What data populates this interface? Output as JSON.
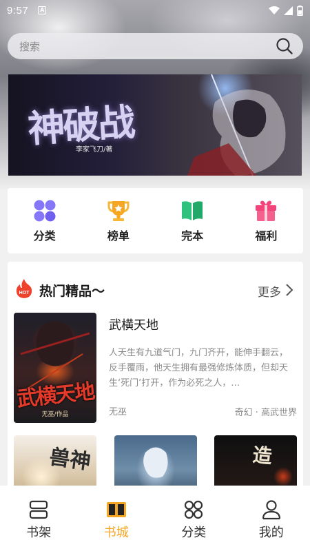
{
  "status_bar": {
    "time": "9:57",
    "notification_glyph": "A"
  },
  "search": {
    "placeholder": "搜索"
  },
  "banner": {
    "title": "神破战",
    "author": "李家飞刀/著"
  },
  "categories": [
    {
      "label": "分类",
      "icon": "grid-icon",
      "color": "#7b6cf6"
    },
    {
      "label": "榜单",
      "icon": "trophy-icon",
      "color": "#f5a623"
    },
    {
      "label": "完本",
      "icon": "book-open-icon",
      "color": "#2ec27e"
    },
    {
      "label": "福利",
      "icon": "gift-icon",
      "color": "#f2437a"
    }
  ],
  "hot_section": {
    "badge": "HOT",
    "title": "热门精品〜",
    "more": "更多",
    "featured": {
      "title": "武横天地",
      "description": "人天生有九道气门，九门齐开，能伸手翻云，反手覆雨，他天生拥有最强修炼体质，但却天生‘死门’打开，作为必死之人，…",
      "author": "无巫",
      "tags": "奇幻 · 高武世界",
      "cover_text": "武横天地",
      "cover_sub": "无巫/作品"
    },
    "thumbnails": [
      {
        "cover_text": "兽神"
      },
      {
        "cover_text": ""
      },
      {
        "cover_text": "造"
      }
    ]
  },
  "bottom_nav": [
    {
      "label": "书架",
      "icon": "bookshelf-icon",
      "active": false
    },
    {
      "label": "书城",
      "icon": "bookstore-icon",
      "active": true
    },
    {
      "label": "分类",
      "icon": "category-icon",
      "active": false
    },
    {
      "label": "我的",
      "icon": "profile-icon",
      "active": false
    }
  ],
  "colors": {
    "accent": "#f5a623",
    "hot_red": "#f0412c"
  }
}
